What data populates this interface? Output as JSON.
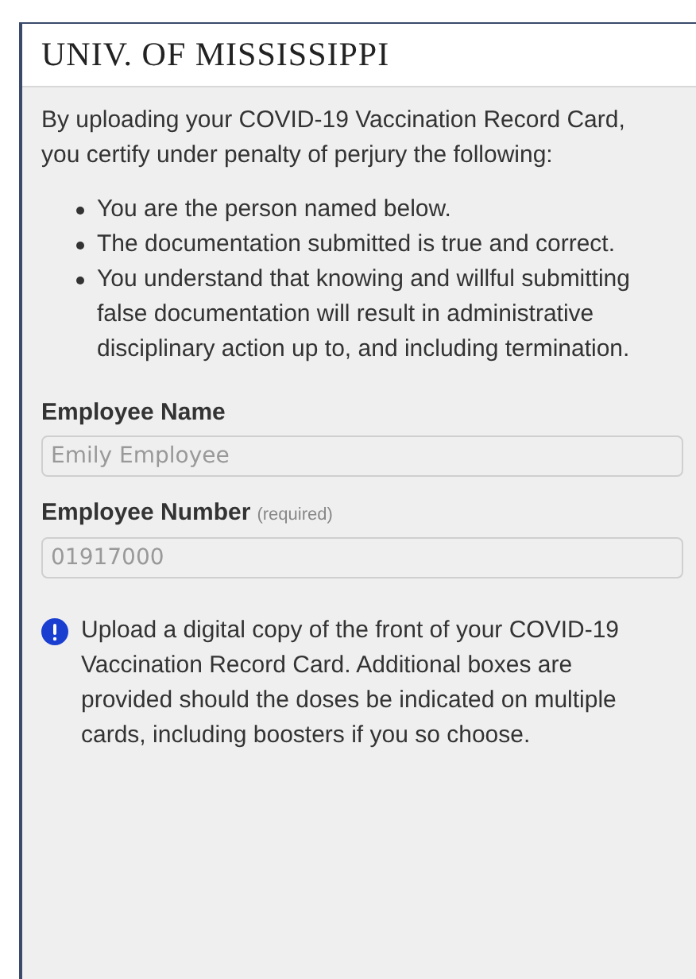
{
  "header": {
    "title": "UNIV. OF MISSISSIPPI"
  },
  "intro": "By uploading your COVID-19 Vaccination Record Card, you certify under penalty of perjury the following:",
  "certifications": [
    "You are the person named below.",
    "The documentation submitted is true and correct.",
    "You understand that knowing and willful submitting false documentation will result in administrative disciplinary action up to, and including termination."
  ],
  "fields": [
    {
      "label": "Employee Name",
      "value": "Emily Employee"
    },
    {
      "label": "Employee Number",
      "note": "(required)",
      "value": "01917000"
    }
  ],
  "notice": {
    "text": "Upload a digital copy of the front of your COVID-19 Vaccination Record Card. Additional boxes are provided should the doses be indicated on multiple cards, including boosters if you so choose."
  }
}
